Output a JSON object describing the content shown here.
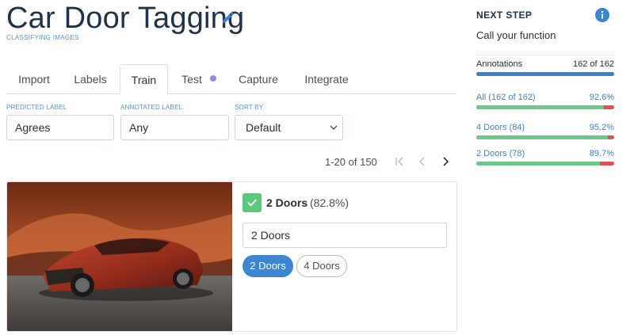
{
  "header": {
    "title": "Car Door Tagging",
    "subtitle": "CLASSIFYING IMAGES"
  },
  "tabs": [
    {
      "label": "Import"
    },
    {
      "label": "Labels"
    },
    {
      "label": "Train",
      "active": true
    },
    {
      "label": "Test",
      "has_dot": true
    },
    {
      "label": "Capture"
    },
    {
      "label": "Integrate"
    }
  ],
  "filters": {
    "predicted": {
      "label": "PREDICTED LABEL",
      "value": "Agrees"
    },
    "annotated": {
      "label": "ANNOTATED LABEL",
      "value": "Any"
    },
    "sort": {
      "label": "SORT BY",
      "value": "Default"
    }
  },
  "pagination": {
    "text": "1-20 of 150"
  },
  "card": {
    "prediction_label": "2 Doors",
    "prediction_pct": "(82.8%)",
    "annotation_value": "2 Doors",
    "options": [
      "2 Doors",
      "4 Doors"
    ],
    "selected_option": "2 Doors"
  },
  "right_panel": {
    "heading": "NEXT STEP",
    "subheading": "Call your function",
    "stats": [
      {
        "label": "Annotations",
        "value": "162 of 162",
        "fraction": 1.0,
        "color": "#3b7fc4"
      },
      {
        "label": "All (162 of 162)",
        "value": "92.6%",
        "fraction": 0.926,
        "color": "#6cc98a"
      },
      {
        "label": "4 Doors (84)",
        "value": "95.2%",
        "fraction": 0.952,
        "color": "#6cc98a"
      },
      {
        "label": "2 Doors (78)",
        "value": "89.7%",
        "fraction": 0.897,
        "color": "#6cc98a"
      }
    ]
  },
  "colors": {
    "accent": "#3b86cf",
    "success": "#5cc87b",
    "error": "#e05252",
    "title": "#1f3247"
  }
}
